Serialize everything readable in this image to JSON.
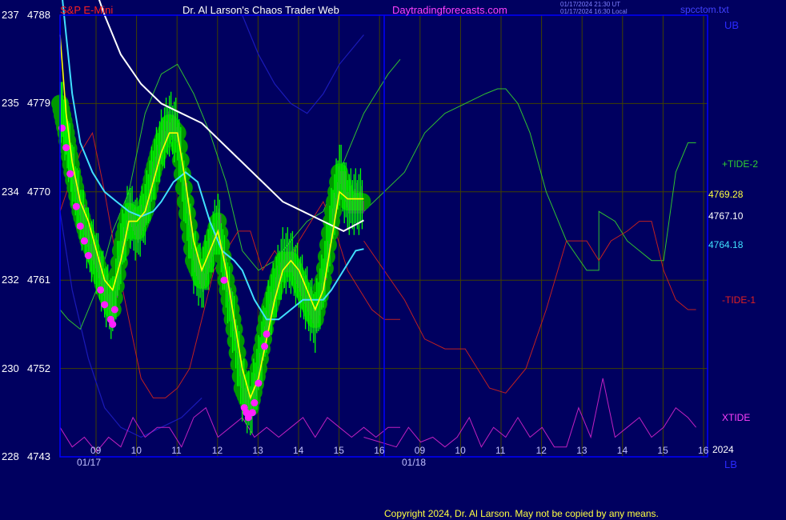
{
  "header": {
    "instrument": "S&P E-Mini",
    "brand": "Dr. Al Larson's Chaos Trader Web",
    "site": "Daytradingforecasts.com",
    "timestamp_ut": "01/17/2024 21:30 UT",
    "timestamp_local": "01/17/2024 16:30 Local",
    "filename": "spcctom.txt"
  },
  "footer": {
    "copyright": "Copyright 2024, Dr. Al Larson. May not be copied by any means."
  },
  "colors": {
    "background": "#000060",
    "frame": "#0000ff",
    "grid": "#404000",
    "price_bars": "#00ff00",
    "glow": "#009900",
    "fast_ma": "#ffff00",
    "mid_ma": "#40e0ff",
    "slow_ma": "#ffffff",
    "tide_plus": "#30c030",
    "tide_minus": "#c02020",
    "band": "#1a1ab8",
    "xtide": "#c020c0",
    "dots": "#ff20ff"
  },
  "chart_data": {
    "type": "line",
    "title": "S&P E-Mini",
    "left_axis_labels": [
      "237",
      "235",
      "234",
      "232",
      "230",
      "228"
    ],
    "right_axis_labels": [
      "4788",
      "4779",
      "4770",
      "4761",
      "4752",
      "4743"
    ],
    "ylim": [
      4743,
      4788
    ],
    "xlim": [
      8.5,
      16.9
    ],
    "x_ticks": [
      "09",
      "10",
      "11",
      "12",
      "13",
      "14",
      "15",
      "16",
      "09",
      "10",
      "11",
      "12",
      "13",
      "14",
      "15",
      "16"
    ],
    "date_labels": [
      "01/17",
      "01/18"
    ],
    "session_break": 16.0,
    "right_labels": {
      "ub": "UB",
      "lb": "LB",
      "tide_plus": "+TIDE-2",
      "tide_minus": "-TIDE-1",
      "xtide": "XTIDE",
      "year": "2024",
      "price_yellow": "4769.28",
      "price_white": "4767.10",
      "price_cyan": "4764.18"
    },
    "series": [
      {
        "name": "close",
        "x": [
          8.5,
          8.65,
          8.8,
          9.0,
          9.2,
          9.4,
          9.6,
          9.8,
          10.0,
          10.2,
          10.4,
          10.6,
          10.8,
          11.0,
          11.2,
          11.4,
          11.6,
          11.8,
          12.0,
          12.2,
          12.4,
          12.6,
          12.8,
          13.0,
          13.2,
          13.4,
          13.6,
          13.8,
          14.0,
          14.2,
          14.4,
          14.6,
          14.8,
          15.0,
          15.2,
          15.4,
          15.6,
          15.8,
          16.0
        ],
        "values": [
          4779,
          4776,
          4772,
          4768,
          4765,
          4763,
          4760,
          4758,
          4764,
          4768,
          4766,
          4768,
          4772,
          4775,
          4777,
          4776,
          4769,
          4763,
          4761,
          4764,
          4767,
          4761,
          4756,
          4750,
          4748,
          4752,
          4757,
          4760,
          4763,
          4763,
          4761,
          4759,
          4757,
          4761,
          4767,
          4772,
          4769,
          4769,
          4769
        ]
      },
      {
        "name": "fast_ma",
        "x": [
          8.5,
          8.65,
          8.8,
          9.0,
          9.2,
          9.4,
          9.6,
          9.8,
          10.0,
          10.2,
          10.4,
          10.6,
          10.8,
          11.0,
          11.2,
          11.4,
          11.6,
          11.8,
          12.0,
          12.2,
          12.4,
          12.6,
          12.8,
          13.0,
          13.2,
          13.4,
          13.6,
          13.8,
          14.0,
          14.2,
          14.4,
          14.6,
          14.8,
          15.0,
          15.2,
          15.4,
          15.6,
          15.8,
          16.0
        ],
        "values": [
          4786,
          4778,
          4773,
          4769,
          4767,
          4764,
          4761,
          4760,
          4763,
          4767,
          4767,
          4768,
          4771,
          4774,
          4776,
          4776,
          4771,
          4765,
          4762,
          4764,
          4766,
          4762,
          4757,
          4752,
          4749,
          4751,
          4755,
          4759,
          4762,
          4763,
          4762,
          4760,
          4758,
          4760,
          4765,
          4770,
          4769.28,
          4769.28,
          4769.28
        ]
      },
      {
        "name": "mid_ma",
        "x": [
          8.5,
          8.8,
          9.0,
          9.3,
          9.6,
          9.9,
          10.2,
          10.5,
          10.8,
          11.0,
          11.3,
          11.6,
          11.9,
          12.2,
          12.5,
          12.8,
          13.0,
          13.3,
          13.6,
          13.9,
          14.2,
          14.5,
          14.8,
          15.0,
          15.2,
          15.5,
          15.8,
          16.0
        ],
        "values": [
          4792,
          4780,
          4775,
          4772,
          4770,
          4769,
          4768,
          4767.5,
          4768,
          4769,
          4771,
          4772,
          4771,
          4767,
          4764,
          4763,
          4762,
          4759,
          4757,
          4757,
          4758,
          4759,
          4759,
          4759,
          4760,
          4762,
          4764,
          4764.18
        ]
      },
      {
        "name": "slow_ma",
        "x": [
          8.5,
          9.0,
          9.6,
          10.0,
          10.5,
          11.0,
          11.5,
          12.0,
          12.5,
          13.0,
          13.5,
          14.0,
          14.5,
          15.0,
          15.5,
          16.0
        ],
        "values": [
          4800,
          4795,
          4788,
          4784,
          4781,
          4779,
          4778,
          4777,
          4775,
          4773,
          4771,
          4769,
          4768,
          4767,
          4766,
          4767.1
        ]
      },
      {
        "name": "+TIDE-2",
        "x": [
          8.5,
          8.7,
          9.0,
          9.4,
          9.8,
          10.2,
          10.6,
          11.0,
          11.4,
          11.8,
          12.2,
          12.6,
          13.0,
          13.4,
          13.8,
          14.2,
          14.6,
          15.0,
          15.4,
          15.8,
          16.0,
          16.3,
          16.6,
          16.9
        ],
        "values": [
          4758,
          4757,
          4756,
          4760,
          4766,
          4770,
          4778,
          4782,
          4783,
          4780,
          4776,
          4771,
          4764,
          4762,
          4763,
          4765,
          4767,
          4768,
          4772,
          4776,
          4778,
          4780,
          4782,
          4783.5
        ]
      },
      {
        "name": "-TIDE-1",
        "x": [
          8.5,
          9.0,
          9.3,
          9.6,
          9.9,
          10.2,
          10.5,
          10.8,
          11.1,
          11.4,
          11.7,
          12.0,
          12.3,
          12.6,
          12.9,
          13.2,
          13.5,
          13.8,
          14.1,
          14.4,
          14.7,
          15.0,
          15.3,
          15.6,
          15.9,
          16.2,
          16.5,
          16.9
        ],
        "values": [
          4768,
          4774,
          4776,
          4770,
          4763,
          4757,
          4751,
          4749,
          4749,
          4750,
          4752,
          4757,
          4762,
          4764,
          4766,
          4766,
          4762,
          4764,
          4762,
          4765,
          4767,
          4769,
          4766,
          4762,
          4760,
          4758,
          4757,
          4757
        ]
      },
      {
        "name": "UB",
        "x": [
          13.0,
          13.4,
          13.8,
          14.2,
          14.6,
          15.0,
          15.4,
          15.8,
          16.0
        ],
        "values": [
          4788,
          4784,
          4781,
          4779,
          4778,
          4780,
          4783,
          4785,
          4786
        ]
      },
      {
        "name": "LB",
        "x": [
          8.5,
          8.8,
          9.2,
          9.6,
          10.0,
          10.5,
          11.0,
          11.5,
          12.0
        ],
        "values": [
          4768,
          4760,
          4753,
          4748,
          4746,
          4745,
          4746,
          4747,
          4749
        ]
      },
      {
        "name": "XTIDE",
        "x": [
          8.5,
          8.8,
          9.1,
          9.4,
          9.7,
          10.0,
          10.3,
          10.6,
          10.9,
          11.2,
          11.5,
          11.8,
          12.1,
          12.4,
          12.7,
          13.0,
          13.3,
          13.6,
          13.9,
          14.2,
          14.5,
          14.8,
          15.1,
          15.4,
          15.7,
          16.0,
          16.3,
          16.6,
          16.9
        ],
        "values": [
          4746,
          4744,
          4745,
          4743.5,
          4745,
          4744,
          4747,
          4745,
          4746,
          4746,
          4744,
          4747,
          4748,
          4745,
          4746,
          4747,
          4745,
          4746,
          4745,
          4746,
          4747,
          4745,
          4747,
          4746,
          4745,
          4746,
          4745,
          4746,
          4746
        ]
      }
    ],
    "future_series": [
      {
        "name": "+TIDE-2",
        "x": [
          16.0,
          16.5,
          17.0,
          17.5,
          18.0,
          18.5,
          18.8,
          19.0,
          19.3,
          19.6,
          20.0,
          20.5,
          21.0,
          21.3,
          21.3,
          21.7,
          22.0,
          22.3,
          22.6,
          22.9,
          23.2,
          23.5,
          23.7
        ],
        "values": [
          4768,
          4772,
          4776,
          4778,
          4779,
          4780,
          4780.5,
          4780.5,
          4779,
          4776,
          4770,
          4765,
          4762,
          4762,
          4768,
          4767,
          4765,
          4764,
          4763,
          4763,
          4772,
          4775,
          4775
        ]
      },
      {
        "name": "-TIDE-1",
        "x": [
          16.0,
          16.5,
          17.0,
          17.5,
          18.0,
          18.3,
          18.6,
          19.0,
          19.5,
          20.0,
          20.5,
          21.0,
          21.3,
          21.6,
          22.0,
          22.3,
          22.6,
          22.9,
          23.2,
          23.5,
          23.7
        ],
        "values": [
          4765,
          4759,
          4755,
          4754,
          4754,
          4752,
          4750,
          4749.5,
          4752,
          4758,
          4765,
          4765,
          4763,
          4765,
          4766,
          4767,
          4767,
          4762,
          4759,
          4758,
          4758
        ]
      },
      {
        "name": "XTIDE",
        "x": [
          16.0,
          16.3,
          16.6,
          16.9,
          17.2,
          17.5,
          17.8,
          18.1,
          18.4,
          18.7,
          19.0,
          19.3,
          19.6,
          19.9,
          20.2,
          20.5,
          20.8,
          21.1,
          21.4,
          21.7,
          22.0,
          22.3,
          22.6,
          22.9,
          23.2,
          23.5,
          23.7
        ],
        "values": [
          4745,
          4744,
          4746,
          4744.5,
          4745,
          4744,
          4745,
          4747,
          4744,
          4746,
          4745,
          4747,
          4745,
          4746,
          4744,
          4744,
          4748,
          4745,
          4751,
          4745,
          4746,
          4747,
          4745,
          4746,
          4748,
          4747,
          4746
        ]
      }
    ]
  }
}
